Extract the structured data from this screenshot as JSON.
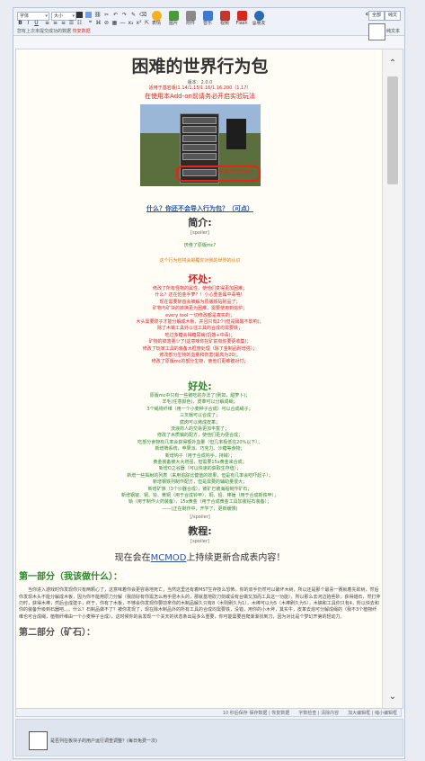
{
  "toolbar": {
    "font_select": "字体",
    "size_select": "大小",
    "tools": [
      {
        "label": "表情",
        "icon": "smiley-icon",
        "color": "#f3b21a"
      },
      {
        "label": "图片",
        "icon": "image-icon",
        "color": "#4c9a3c"
      },
      {
        "label": "附件",
        "icon": "attachment-icon",
        "color": "#8a8a8a"
      },
      {
        "label": "音乐",
        "icon": "music-icon",
        "color": "#3a7ad0"
      },
      {
        "label": "视频",
        "icon": "video-icon",
        "color": "#c0392b"
      },
      {
        "label": "Flash",
        "icon": "flash-icon",
        "color": "#d22a1f"
      },
      {
        "label": "@朋友",
        "icon": "at-icon",
        "color": "#2a6ab0"
      }
    ],
    "mode_left": "全部",
    "mode_right": "纯文",
    "hint_text": "您有上次未提交成功的数据",
    "hint_link": "恢复数据",
    "side_label": "纯文本"
  },
  "post": {
    "title": "困难的世界行为包",
    "version": "版本：2.0.0",
    "compat": "适用于基岩版(1.14/1.15/1.16/1.16.200（1.17）",
    "need_addon": "在使用本Add-on前请务必开启实验玩法",
    "screenshot_caption": "这里请打开实验性玩法",
    "link_import": "什么？你还不会导入行为包？（可点）",
    "intro_heading": "简介:",
    "spoiler": "[spoiler]",
    "spoiler_end": "[/spoiler]",
    "tired_line": "厌倦了原版mc?",
    "orange_line": "这个行为包将会颠覆你对我的世界的认识",
    "bad_heading": "坏处:",
    "bad_lines": [
      "修改了所有怪物的属性，使他们变得更加困难；",
      "什么？还在怕金手萝？！小心重金属中毒咯！",
      "现在需要斩首会被解为原版铁砧耐品了；",
      "矿物与矿块的转换更为困难，需要使用到熔炉；",
      "every tool 一切修改都是真实的；",
      "木头需要瓒子才能分解成木板，并且只有2个(但是硝酸不影响)；",
      "除了木镐工具外以往工具的合成均需要铁；",
      "吃过多糖会得糖尿病(饥饿+中毒)；",
      "矿物的掉落量少了(这意味你挖矿前有你要更收集)；",
      "修改了玩家工具的装备大框度处理（除了金制品耐增强）；",
      "修改部分生物的血量和伤害(最高为20)；",
      "修改了原版mc的部分生物，使他们更难被对付；"
    ],
    "good_heading": "好处:",
    "good_lines": [
      "原版mc中只有一些被吃的办法了(例如，甜萝卜)；",
      "羊毛(任意颜色)，皮革可以分解成绳；",
      "3个绳将纤维（用一个小麦种子合成）可以合成绳子；",
      "三叉戟可以合成了；",
      "腐肉可以烤成皮革；",
      "流浪商人的交易更加丰富了；",
      "修改了木质镐的配方，使他们更为便合成；",
      "吃部分食物有几率会获得额外血量（但几率极低在20%以下）；",
      "新增牌系统，苹果派、巧克力、沙糖等食物；",
      "新增钩子（用于合成钩手，持械）；",
      "黄金装备被大大增强，但需要15x黄金来合成；",
      "新增O之谷器（可以快速的获取生存值）；",
      "新增一些揭射的列表（来用追踪比健值的效果，但是有几率会吃吓起子）；",
      "新增钢铁列制作配方，但是需要的辅助量很大；",
      "新增矿族（3个沙器合成），被矿已被海船制作矿石；",
      "新增钢锭、铜、铃、黄铜（用于合成铃甲）、铜、铅、棒锤（用于合成新铁甲）；",
      "锁（用于制作火药装备），15x黄金（用于合成黄金工具加装钻石装备）；",
      "——(正在制作中，开学了，更新缓慢)"
    ],
    "tutorial_heading": "教程:",
    "mcmod_pre": "现在会在",
    "mcmod_link": "MCMOD",
    "mcmod_post": "上持续更新合成表内容！",
    "part1": "第一部分（我该做什么）：",
    "part1_text": "当你进入游戏时你发现你只有两颗心了，这意味着你会更容易地死亡，当然这里还有着MST生存技么恐怖。你的双手仍然可以破坏木树，所以还是那个最喜一赛就着先砍树，然后你发现木头不能分解成木板，因为你不能用原力分解（我前好有你需怎么用手把木头的，那就基地砍刀剑或设有台做又加而工具这一功能），所以那么去河边拾些砂，获得燧石，然打斧刃时，获得木棒，然后合成建子，终于，你有了木板，不够会你发现你要前拿你的木制品解久只有8（木则刷久为1），木棒可以为5（木棒刷久为5），木镐和工具你只有4，所以快去和你的装备升级到石器吧。。。什么？石制品做不了？被你发现了，现在除木制品外的所有工具的合成均需要铁，没错，用你的小木斧，其实牛，皮革去熔可分解成绳的（我不3个植物纤维也可合成绳，植物纤维由一个小麦种子合成），这时候你的会发现一个关天的状态条出是多么重要，你可能需要自爬渐渐找到刀，因为对比是个梦幻开第的轻动力。",
    "part2": "第二部分（矿石）："
  },
  "statusbar": {
    "text": "10 秒后保存 保存数据 | 恢复数据　　字数检查 | 清除内容　　加大编辑框 | 缩小编辑框"
  },
  "bottom": {
    "label": "是否列在板块子的用户运行调查调整？(每日免费一次)"
  }
}
